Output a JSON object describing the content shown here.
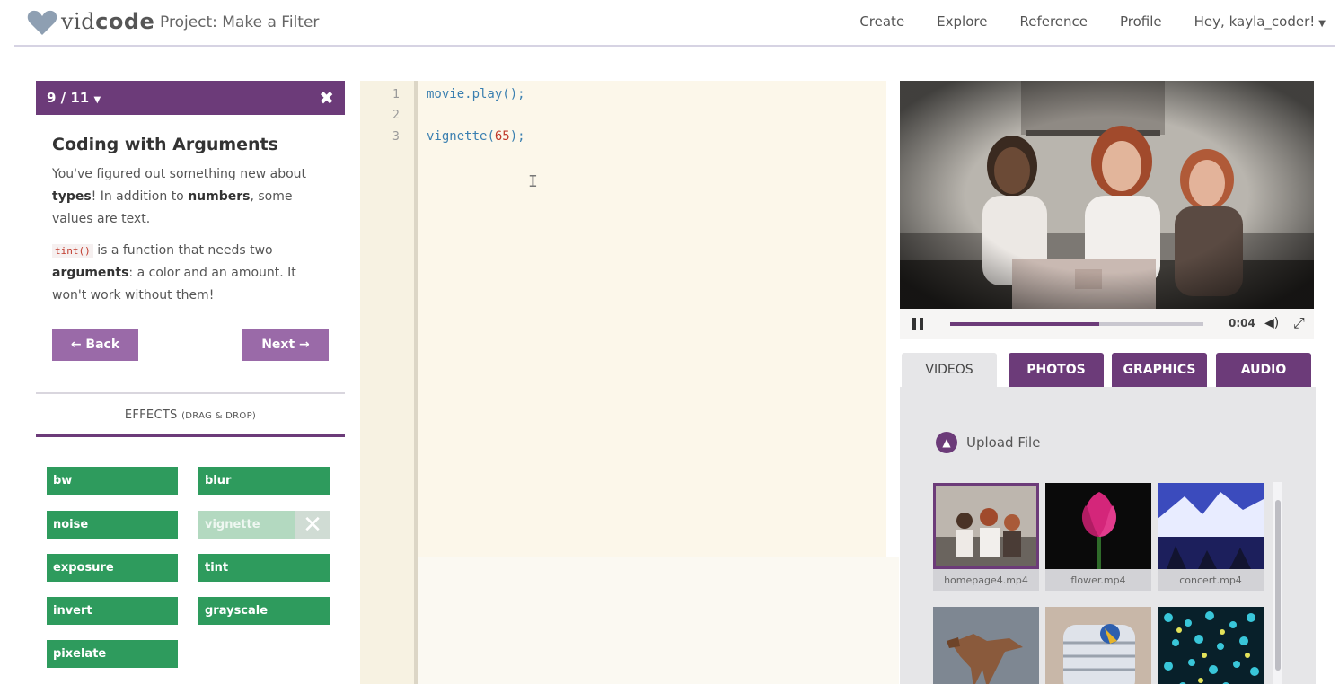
{
  "brand": {
    "logo_light": "vid",
    "logo_bold": "code"
  },
  "project": {
    "label": "Project: Make a Filter"
  },
  "nav": {
    "create": "Create",
    "explore": "Explore",
    "reference": "Reference",
    "profile": "Profile",
    "user_greeting": "Hey, kayla_coder!"
  },
  "lesson": {
    "step": "9 / 11",
    "title": "Coding with Arguments",
    "p1_a": "You've figured out something new about ",
    "p1_types": "types",
    "p1_b": "! In addition to ",
    "p1_numbers": "numbers",
    "p1_c": ", some values are text.",
    "p2_code": "tint()",
    "p2_a": " is a function that needs two ",
    "p2_arguments": "arguments",
    "p2_b": ": a color and an amount. It won't work without them!",
    "back_label": "← Back",
    "next_label": "Next →"
  },
  "effects": {
    "title": "EFFECTS",
    "hint": "(DRAG & DROP)",
    "items": [
      "bw",
      "blur",
      "noise",
      "vignette",
      "exposure",
      "tint",
      "invert",
      "grayscale",
      "pixelate"
    ],
    "disabled": [
      "vignette"
    ]
  },
  "editor": {
    "line_numbers": [
      "1",
      "2",
      "3"
    ],
    "lines": [
      {
        "fn": "movie.play",
        "arg": "",
        "end": "();"
      },
      {
        "fn": "",
        "arg": "",
        "end": ""
      },
      {
        "fn": "vignette",
        "arg": "65",
        "end": ");"
      }
    ]
  },
  "player": {
    "time": "0:04",
    "progress": 0.59
  },
  "media_tabs": {
    "videos": "VIDEOS",
    "photos": "PHOTOS",
    "graphics": "GRAPHICS",
    "audio": "AUDIO",
    "active": "VIDEOS"
  },
  "media": {
    "upload_label": "Upload File",
    "files": [
      "homepage4.mp4",
      "flower.mp4",
      "concert.mp4"
    ]
  },
  "colors": {
    "brand_purple": "#6c3b79",
    "button_purple": "#9a6aa8",
    "effect_green": "#2e9b5d",
    "code_blue": "#3a7fb0",
    "code_number": "#c0392b"
  }
}
